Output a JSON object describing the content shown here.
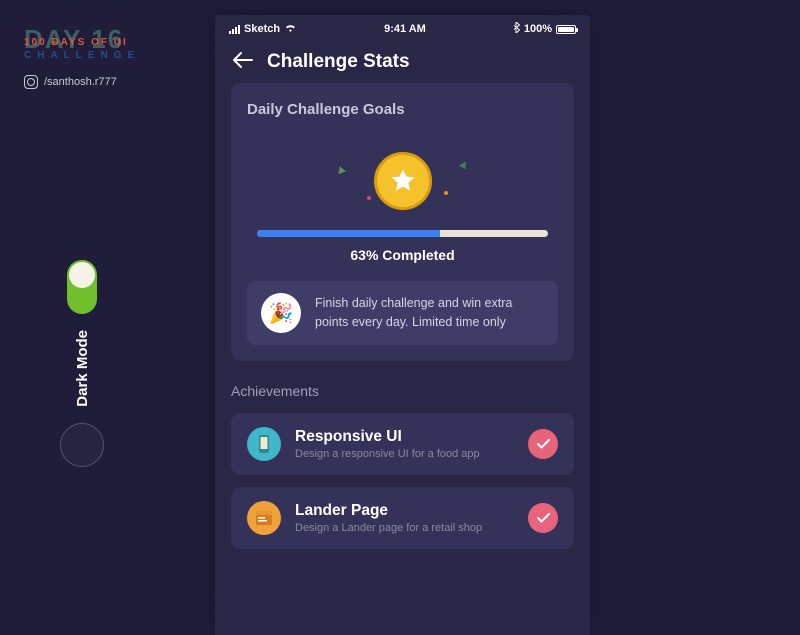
{
  "brand": {
    "day": "DAY 16",
    "subtitle": "100 DAYS OF UI",
    "challenge": "CHALLENGE",
    "handle": "/santhosh.r777"
  },
  "toggle": {
    "label": "Dark Mode"
  },
  "status": {
    "carrier": "Sketch",
    "time": "9:41 AM",
    "battery": "100%"
  },
  "header": {
    "title": "Challenge Stats"
  },
  "goals": {
    "title": "Daily Challenge Goals",
    "percent": "63% Completed",
    "info": "Finish daily challenge and win extra points every day. Limited time only"
  },
  "achievements": {
    "section_title": "Achievements",
    "items": [
      {
        "title": "Responsive UI",
        "subtitle": "Design a responsive UI for a food app"
      },
      {
        "title": "Lander Page",
        "subtitle": "Design a Lander page for a retail shop"
      }
    ]
  }
}
